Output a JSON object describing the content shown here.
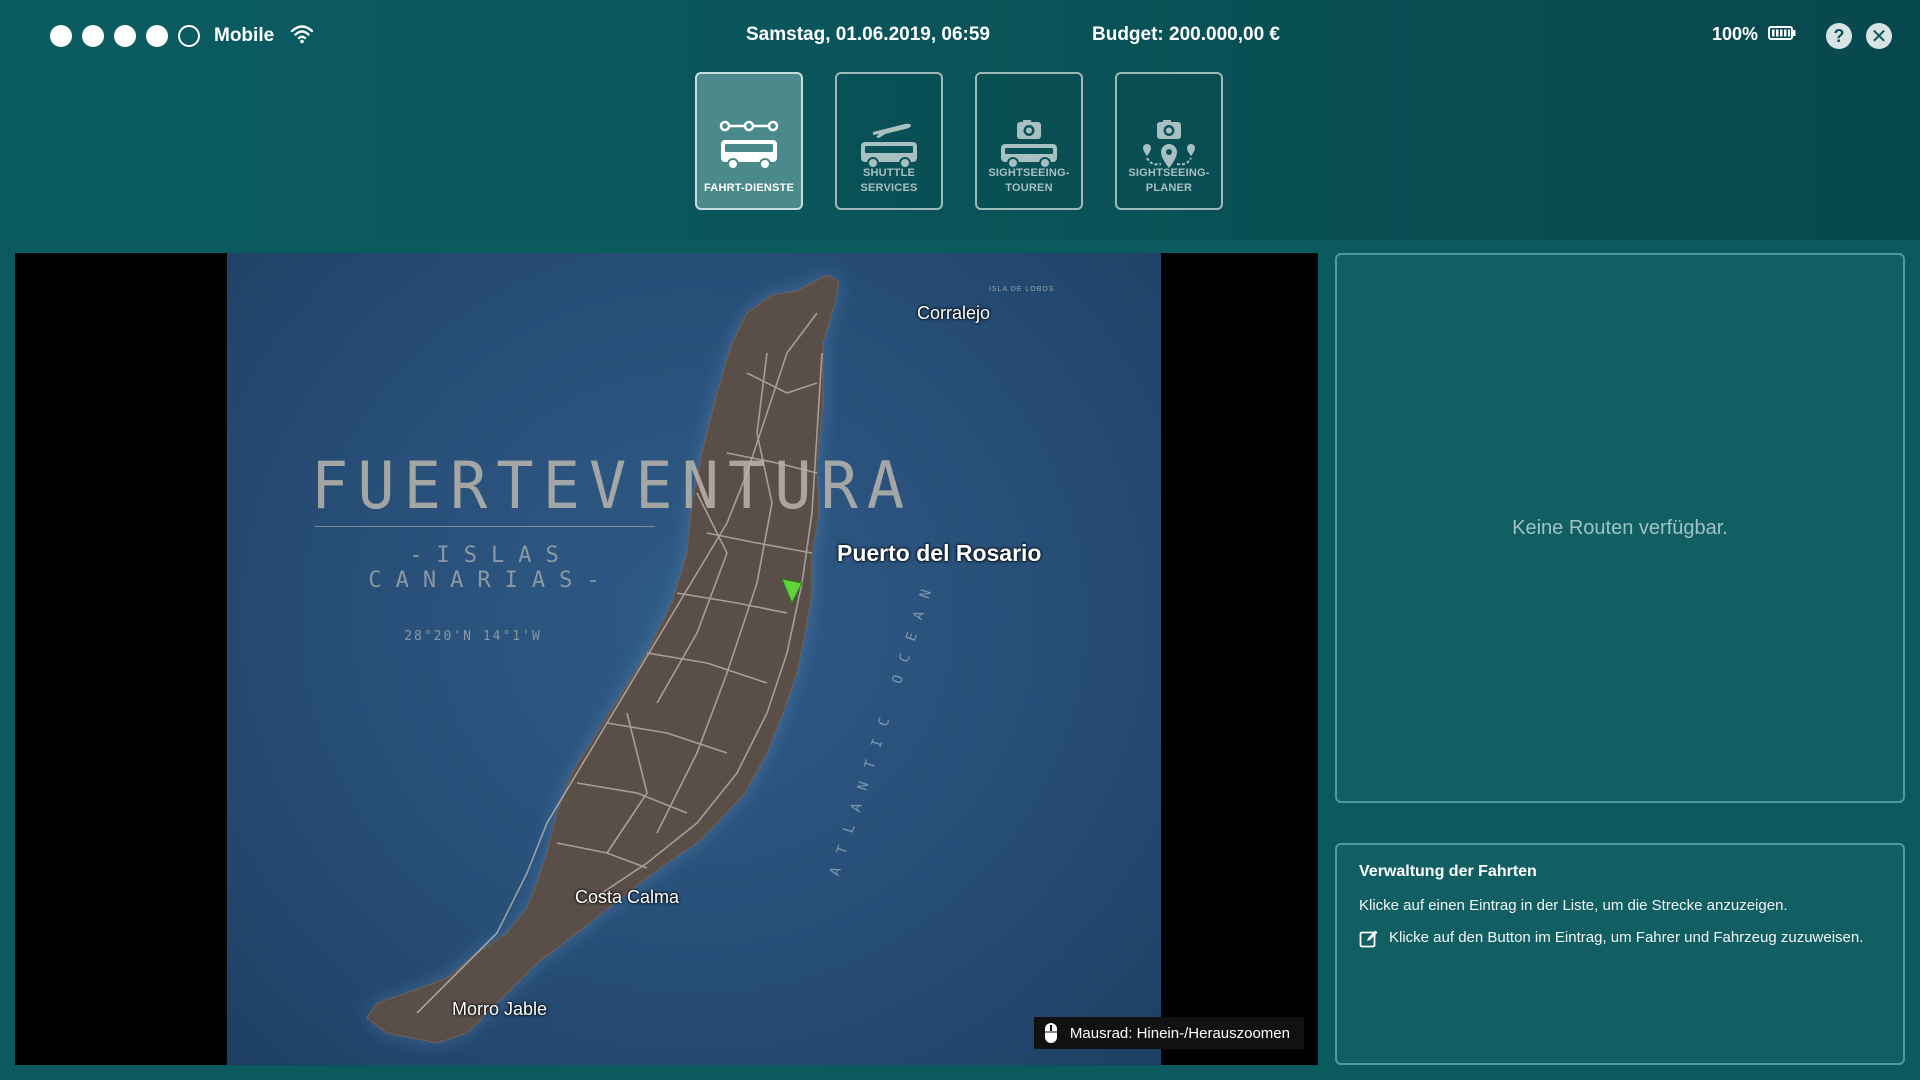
{
  "status": {
    "carrier": "Mobile",
    "datetime": "Samstag, 01.06.2019, 06:59",
    "budget": "Budget: 200.000,00 €",
    "battery": "100%"
  },
  "nav": [
    {
      "label": "FAHRT-DIENSTE",
      "active": true,
      "icon": "route-bus-icon"
    },
    {
      "label": "SHUTTLE\nSERVICES",
      "active": false,
      "icon": "plane-bus-icon"
    },
    {
      "label": "SIGHTSEEING-\nTOUREN",
      "active": false,
      "icon": "camera-bus-icon"
    },
    {
      "label": "SIGHTSEEING-\nPLANER",
      "active": false,
      "icon": "camera-pin-icon"
    }
  ],
  "map": {
    "title": "FUERTEVENTURA",
    "subtitle": "-ISLAS CANARIAS-",
    "coords": "28°20'N 14°1'W",
    "ocean": "ATLANTIC OCEAN",
    "isla": "ISLA DE LOBOS",
    "cities": {
      "corralejo": "Corralejo",
      "puerto": "Puerto del Rosario",
      "costa": "Costa Calma",
      "morro": "Morro Jable"
    },
    "zoom_hint": "Mausrad: Hinein-/Herauszoomen"
  },
  "routes": {
    "empty_text": "Keine Routen verfügbar."
  },
  "info": {
    "title": "Verwaltung der Fahrten",
    "line1": "Klicke auf einen Eintrag in der Liste, um die Strecke anzuzeigen.",
    "line2": "Klicke auf den Button im Eintrag, um Fahrer und Fahrzeug zuzuweisen."
  },
  "colors": {
    "accent": "#4a8a8a",
    "marker": "#5fd33a",
    "background": "#0a5a5e"
  }
}
